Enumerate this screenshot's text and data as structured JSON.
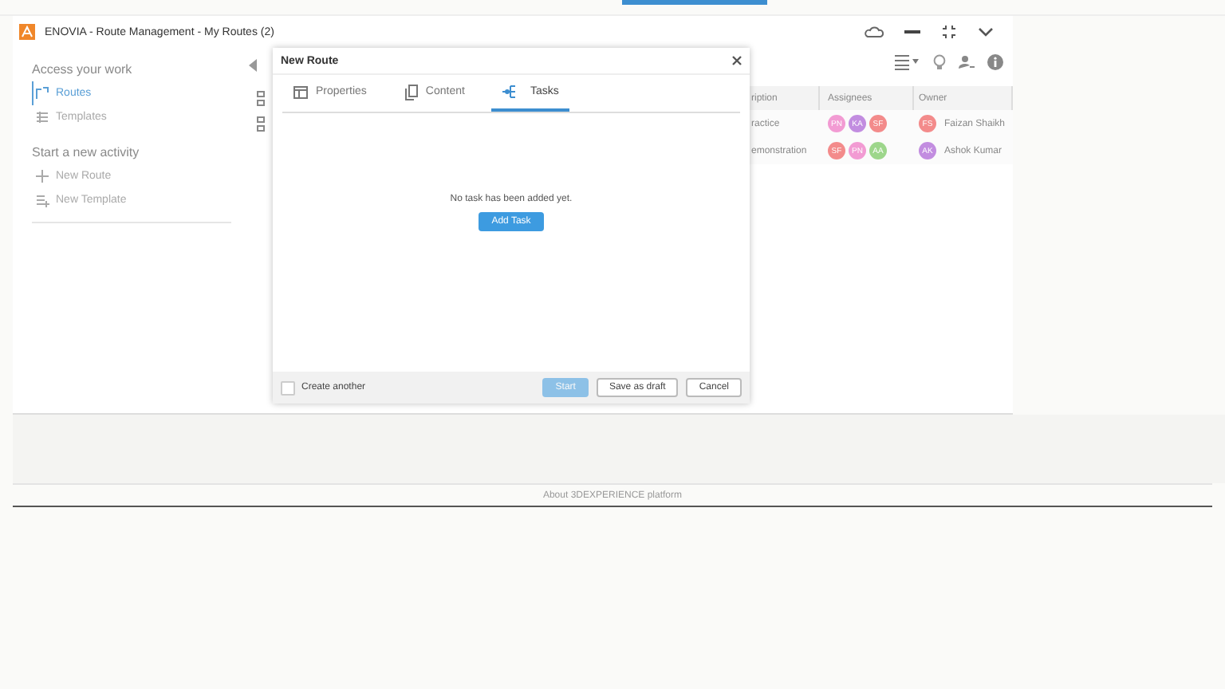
{
  "window": {
    "title": "ENOVIA - Route Management - My Routes (2)"
  },
  "sidebar": {
    "sections": [
      {
        "heading": "Access your work",
        "items": [
          {
            "label": "Routes",
            "selected": true
          },
          {
            "label": "Templates",
            "selected": false
          }
        ]
      },
      {
        "heading": "Start a new activity",
        "items": [
          {
            "label": "New Route",
            "selected": false
          },
          {
            "label": "New Template",
            "selected": false
          }
        ]
      }
    ]
  },
  "table": {
    "columns": [
      "ription",
      "Assignees",
      "Owner"
    ],
    "rows": [
      {
        "description": "ractice",
        "assignees": [
          {
            "initials": "PN",
            "color": "#f29bd3"
          },
          {
            "initials": "KA",
            "color": "#c28de0"
          },
          {
            "initials": "SF",
            "color": "#f38b8b"
          }
        ],
        "owner": {
          "initials": "FS",
          "color": "#f38b8b",
          "name": "Faizan Shaikh"
        }
      },
      {
        "description": "emonstration",
        "assignees": [
          {
            "initials": "SF",
            "color": "#f38b8b"
          },
          {
            "initials": "PN",
            "color": "#f29bd3"
          },
          {
            "initials": "AA",
            "color": "#9dd68b"
          }
        ],
        "owner": {
          "initials": "AK",
          "color": "#c28de0",
          "name": "Ashok Kumar"
        }
      }
    ]
  },
  "dialog": {
    "title": "New Route",
    "tabs": [
      {
        "label": "Properties",
        "selected": false
      },
      {
        "label": "Content",
        "selected": false
      },
      {
        "label": "Tasks",
        "selected": true
      }
    ],
    "empty_message": "No task has been added yet.",
    "add_button": "Add Task",
    "create_another": {
      "label": "Create another",
      "checked": false
    },
    "buttons": [
      {
        "label": "Start",
        "kind": "primary",
        "disabled": true
      },
      {
        "label": "Save as draft",
        "kind": "default",
        "disabled": false
      },
      {
        "label": "Cancel",
        "kind": "default",
        "disabled": false
      }
    ]
  },
  "footer": {
    "link": "About 3DEXPERIENCE platform"
  }
}
